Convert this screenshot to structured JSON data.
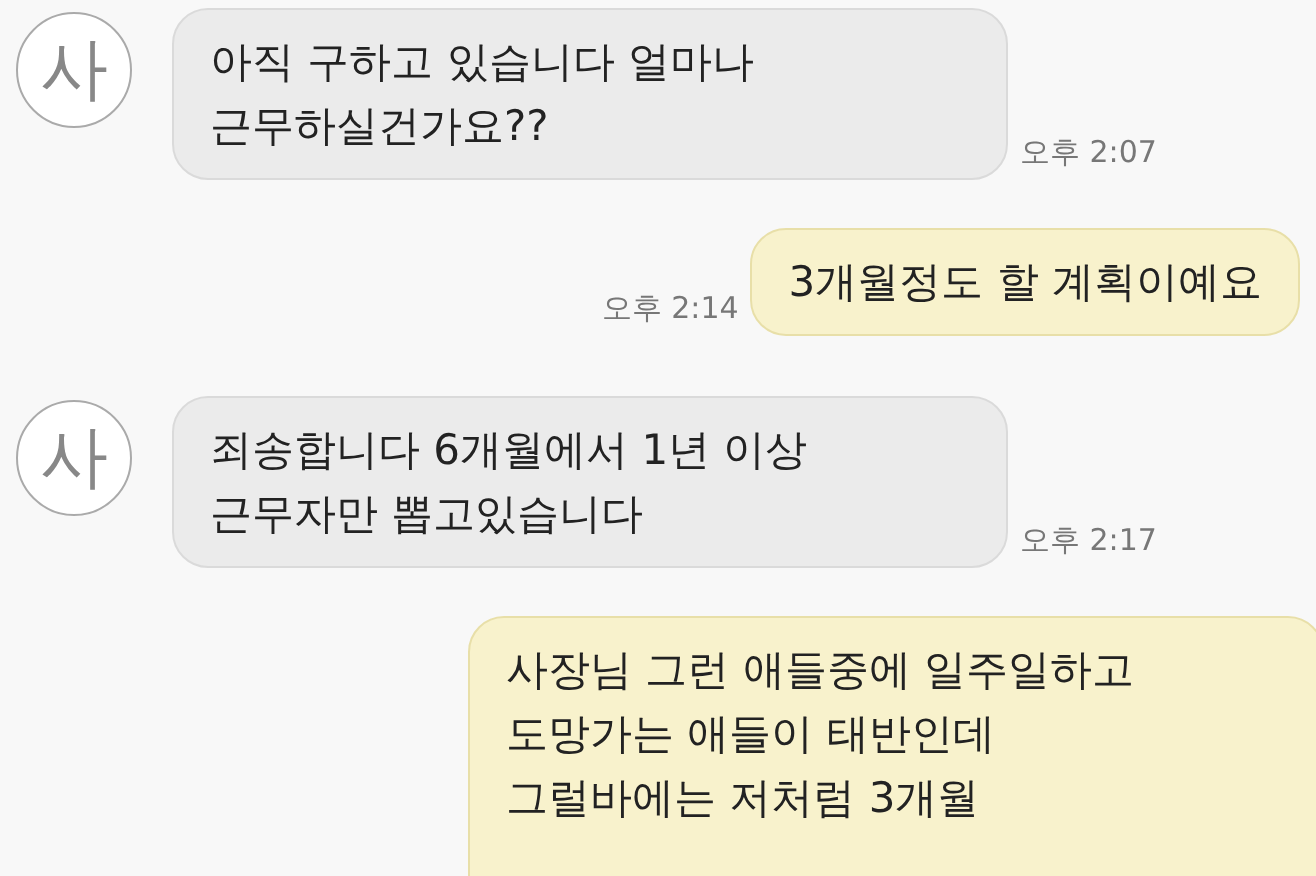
{
  "messages": [
    {
      "kind": "received",
      "avatar": "사",
      "lines": [
        "아직 구하고 있습니다 얼마나",
        "근무하실건가요??"
      ],
      "time": "오후 2:07"
    },
    {
      "kind": "sent",
      "lines": [
        "3개월정도 할 계획이예요"
      ],
      "time": "오후 2:14"
    },
    {
      "kind": "received",
      "avatar": "사",
      "lines": [
        "죄송합니다 6개월에서 1년 이상",
        "근무자만 뽑고있습니다"
      ],
      "time": "오후 2:17"
    },
    {
      "kind": "sent",
      "lines": [
        "사장님 그런 애들중에 일주일하고",
        "도망가는 애들이 태반인데",
        "그럴바에는 저처럼 3개월"
      ]
    }
  ]
}
